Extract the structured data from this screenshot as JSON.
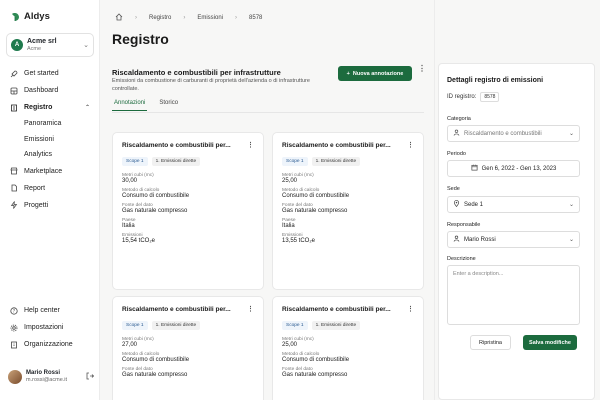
{
  "app": {
    "name": "Aldys"
  },
  "org": {
    "initials": "A",
    "name": "Acme srl",
    "sub": "Acme"
  },
  "nav": {
    "get_started": "Get started",
    "dashboard": "Dashboard",
    "registro": "Registro",
    "panoramica": "Panoramica",
    "emissioni": "Emissioni",
    "analytics": "Analytics",
    "marketplace": "Marketplace",
    "report": "Report",
    "progetti": "Progetti",
    "help": "Help center",
    "impostazioni": "Impostazioni",
    "organizzazione": "Organizzazione"
  },
  "user": {
    "name": "Mario Rossi",
    "email": "m.rossi@acme.it"
  },
  "breadcrumb": {
    "home_icon": "home-icon",
    "items": [
      "Registro",
      "Emissioni",
      "8578"
    ]
  },
  "page": {
    "title": "Registro"
  },
  "section": {
    "title": "Riscaldamento e combustibili per infrastrutture",
    "description": "Emissioni da combustione di carburanti di proprietà dell'azienda o di infrastrutture controllate.",
    "add_button": "Nuova annotazione"
  },
  "tabs": [
    "Annotazioni",
    "Storico"
  ],
  "cards": [
    {
      "title": "Riscaldamento e combustibili per...",
      "scope": "Scope 1",
      "category": "1. Emissioni dirette",
      "f1_label": "Metri cubi (mc)",
      "f1_value": "30,00",
      "f2_label": "Metodo di calcolo",
      "f2_value": "Consumo di combustibile",
      "f3_label": "Fonte del dato",
      "f3_value": "Gas naturale compresso",
      "f4_label": "Paese",
      "f4_value": "Italia",
      "f5_label": "Emissioni",
      "f5_value": "15,54 tCO₂e"
    },
    {
      "title": "Riscaldamento e combustibili per...",
      "scope": "Scope 1",
      "category": "1. Emissioni dirette",
      "f1_label": "Metri cubi (mc)",
      "f1_value": "25,00",
      "f2_label": "Metodo di calcolo",
      "f2_value": "Consumo di combustibile",
      "f3_label": "Fonte del dato",
      "f3_value": "Gas naturale compresso",
      "f4_label": "Paese",
      "f4_value": "Italia",
      "f5_label": "Emissioni",
      "f5_value": "13,55 tCO₂e"
    },
    {
      "title": "Riscaldamento e combustibili per...",
      "scope": "Scope 1",
      "category": "1. Emissioni dirette",
      "f1_label": "Metri cubi (mc)",
      "f1_value": "27,00",
      "f2_label": "Metodo di calcolo",
      "f2_value": "Consumo di combustibile",
      "f3_label": "Fonte del dato",
      "f3_value": "Gas naturale compresso"
    },
    {
      "title": "Riscaldamento e combustibili per...",
      "scope": "Scope 1",
      "category": "1. Emissioni dirette",
      "f1_label": "Metri cubi (mc)",
      "f1_value": "25,00",
      "f2_label": "Metodo di calcolo",
      "f2_value": "Consumo di combustibile",
      "f3_label": "Fonte del dato",
      "f3_value": "Gas naturale compresso"
    }
  ],
  "panel": {
    "title": "Dettagli registro di emissioni",
    "id_label": "ID registro:",
    "id_value": "8578",
    "categoria_label": "Categoria",
    "categoria_value": "Riscaldamento e combustibili",
    "periodo_label": "Periodo",
    "periodo_value": "Gen 6, 2022 - Gen 13, 2023",
    "sede_label": "Sede",
    "sede_value": "Sede 1",
    "resp_label": "Responsabile",
    "resp_value": "Mario Rossi",
    "desc_label": "Descrizione",
    "desc_placeholder": "Enter a description...",
    "reset": "Ripristina",
    "save": "Salva modifiche"
  },
  "colors": {
    "primary": "#1c6b3e",
    "badge_bg": "#eef4fb"
  }
}
